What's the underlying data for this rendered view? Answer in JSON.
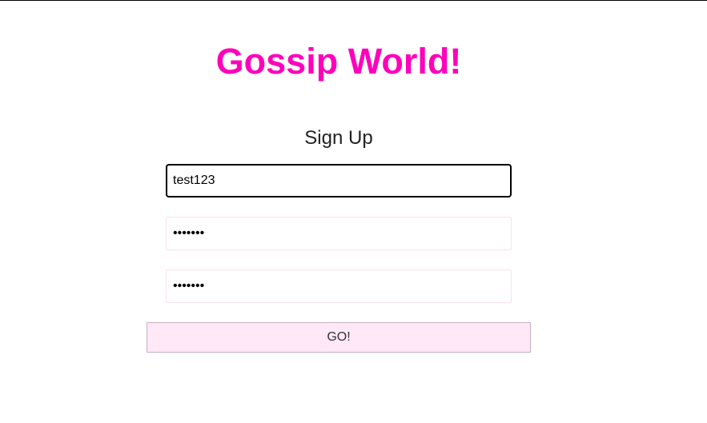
{
  "app": {
    "title": "Gossip World!",
    "brand_color": "#ff00bb"
  },
  "signup": {
    "heading": "Sign Up",
    "username_value": "test123",
    "password_value": "1234567",
    "confirm_password_value": "1234567",
    "submit_label": "GO!"
  }
}
